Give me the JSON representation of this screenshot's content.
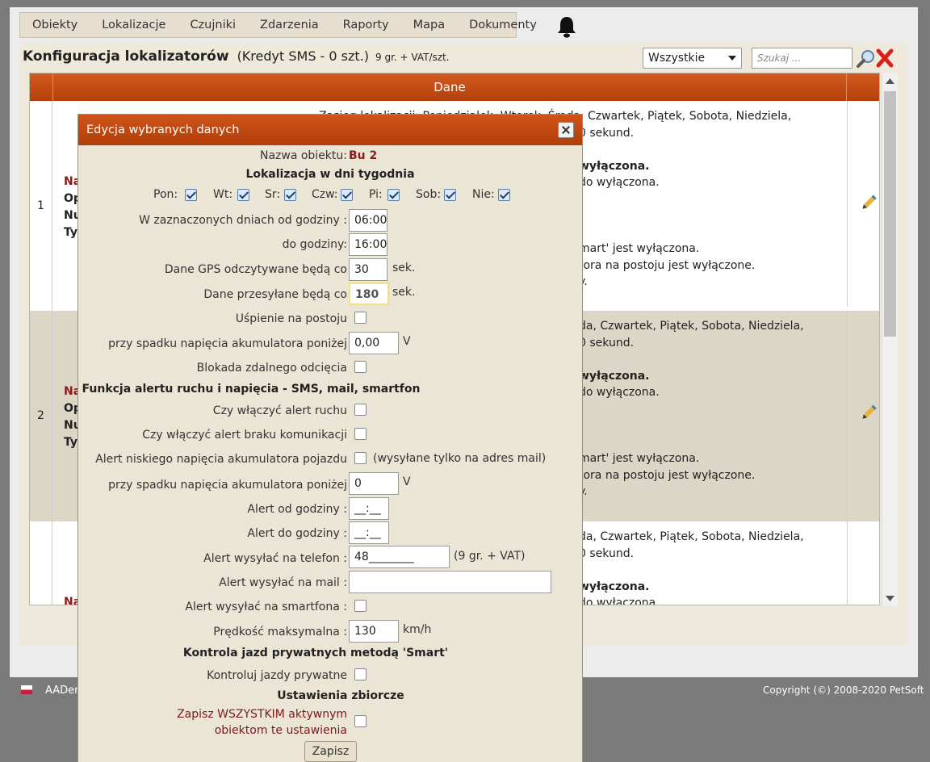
{
  "menu": [
    "Obiekty",
    "Lokalizacje",
    "Czujniki",
    "Zdarzenia",
    "Raporty",
    "Mapa",
    "Dokumenty"
  ],
  "header": {
    "title": "Konfiguracja lokalizatorów",
    "credit": "(Kredyt SMS - 0 szt.)",
    "price": "9 gr. + VAT/szt.",
    "filter_value": "Wszystkie",
    "search_placeholder": "Szukaj ..."
  },
  "table": {
    "column_header": "Dane",
    "rows": [
      {
        "num": "1",
        "labels": [
          "Na",
          "Op",
          "Nu",
          "Ty"
        ],
        "lines": [
          "Zasięg lokalizacji: Poniedziałek, Wtorek, Środa, Czwartek, Piątek, Sobota, Niedziela,",
          "0 sekund.",
          "",
          "wyłączona.",
          "do wyłączona.",
          "",
          "",
          "",
          "mart' jest wyłączona.",
          "tora na postoju jest wyłączone.",
          "y."
        ]
      },
      {
        "num": "2",
        "labels": [
          "Na",
          "Op",
          "Nu",
          "Ty"
        ],
        "lines": [
          "da, Czwartek, Piątek, Sobota, Niedziela,",
          "0 sekund.",
          "",
          "wyłączona.",
          "do wyłączona.",
          "",
          "",
          "",
          "mart' jest wyłączona.",
          "tora na postoju jest wyłączone.",
          "y."
        ]
      },
      {
        "num": "",
        "labels": [
          "",
          "",
          "",
          "",
          "Na"
        ],
        "lines": [
          "da, Czwartek, Piątek, Sobota, Niedziela,",
          "0 sekund.",
          "",
          "wyłączona.",
          "do wyłączona."
        ]
      }
    ]
  },
  "dialog": {
    "title": "Edycja wybranych danych",
    "object_label": "Nazwa obiektu:",
    "object_value": "Bu 2",
    "section_days": "Lokalizacja w dni tygodnia",
    "days": [
      {
        "label": "Pon:",
        "checked": true
      },
      {
        "label": "Wt:",
        "checked": true
      },
      {
        "label": "Sr:",
        "checked": true
      },
      {
        "label": "Czw:",
        "checked": true
      },
      {
        "label": "Pi:",
        "checked": true
      },
      {
        "label": "Sob:",
        "checked": true
      },
      {
        "label": "Nie:",
        "checked": true
      }
    ],
    "from_label": "W zaznaczonych dniach od godziny :",
    "from_value": "06:00",
    "to_label": "do godziny:",
    "to_value": "16:00",
    "gps_label": "Dane GPS odczytywane będą co",
    "gps_value": "30",
    "gps_unit": "sek.",
    "send_label": "Dane przesyłane będą co",
    "send_value": "180",
    "send_unit": "sek.",
    "sleep_label": "Uśpienie na postoju",
    "sleep_voltage_label": "przy spadku napięcia akumulatora poniżej",
    "sleep_voltage_value": "0,00",
    "voltage_unit": "V",
    "remote_block_label": "Blokada zdalnego odcięcia",
    "section_alert": "Funkcja alertu ruchu i napięcia - SMS, mail, smartfon",
    "motion_alert_label": "Czy włączyć alert ruchu",
    "comm_alert_label": "Czy włączyć alert braku komunikacji",
    "low_voltage_label": "Alert niskiego napięcia akumulatora pojazdu",
    "low_voltage_note": "(wysyłane tylko na adres mail)",
    "alert_voltage_label": "przy spadku napięcia akumulatora poniżej",
    "alert_voltage_value": "0",
    "alert_from_label": "Alert od godziny :",
    "alert_from_value": "__:__",
    "alert_to_label": "Alert do godziny :",
    "alert_to_value": "__:__",
    "phone_label": "Alert wysyłać na telefon :",
    "phone_value": "48________",
    "phone_note": "(9 gr. + VAT)",
    "mail_label": "Alert wysyłać na mail :",
    "mail_value": "",
    "smartphone_label": "Alert wysyłać na smartfona :",
    "speed_label": "Prędkość maksymalna :",
    "speed_value": "130",
    "speed_unit": "km/h",
    "section_private": "Kontrola jazd prywatnych metodą 'Smart'",
    "private_label": "Kontroluj jazdy prywatne",
    "section_bulk": "Ustawienia zbiorcze",
    "bulk_label_1": "Zapisz WSZYSTKIM aktywnym",
    "bulk_label_2": "obiektom te ustawienia",
    "save_label": "Zapisz"
  },
  "footer": {
    "app": "AADen",
    "copyright": "Copyright (©) 2008-2020 PetSoft"
  },
  "colors": {
    "header_accent": "#c24a12",
    "panel_bg": "#efe9dc",
    "dialog_bg": "#ebe5d6",
    "bulk_text": "#7a1a1a",
    "object_name": "#8b1a1a"
  }
}
